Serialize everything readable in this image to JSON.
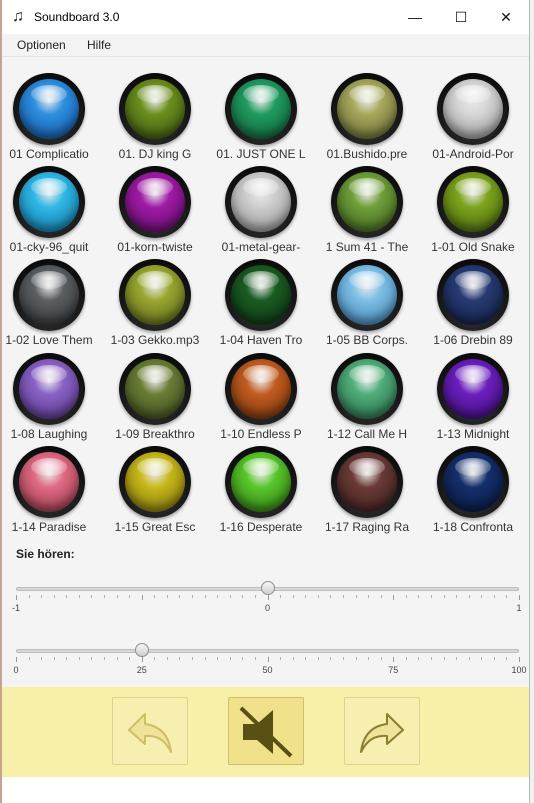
{
  "window": {
    "title": "Soundboard 3.0",
    "app_icon": "music-note-icon",
    "controls": [
      "minimize-icon",
      "maximize-icon",
      "close-icon"
    ],
    "min_glyph": "—",
    "max_glyph": "☐",
    "close_glyph": "✕"
  },
  "menu": [
    "Optionen",
    "Hilfe"
  ],
  "sounds": [
    {
      "label": "01 Complicatio",
      "color": "#2e8fe0",
      "dark": "#0f4f9a"
    },
    {
      "label": "01. DJ king G",
      "color": "#6b8f1c",
      "dark": "#365010"
    },
    {
      "label": "01. JUST ONE L",
      "color": "#1f9b5f",
      "dark": "#0f5c36"
    },
    {
      "label": "01.Bushido.pre",
      "color": "#a7a85a",
      "dark": "#5f6030"
    },
    {
      "label": "01-Android-Por",
      "color": "#d6d6d6",
      "dark": "#8a8a8a"
    },
    {
      "label": "01-cky-96_quit",
      "color": "#30b8e6",
      "dark": "#106f9a"
    },
    {
      "label": "01-korn-twiste",
      "color": "#a01aa6",
      "dark": "#5c0c62"
    },
    {
      "label": "01-metal-gear-",
      "color": "#cdcdcd",
      "dark": "#8a8a8a"
    },
    {
      "label": "1 Sum 41 - The",
      "color": "#6e9f38",
      "dark": "#3d5c1c"
    },
    {
      "label": "1-01 Old Snake",
      "color": "#7da31c",
      "dark": "#44600e"
    },
    {
      "label": "1-02 Love Them",
      "color": "#5a5f63",
      "dark": "#2e3133"
    },
    {
      "label": "1-03 Gekko.mp3",
      "color": "#9aa630",
      "dark": "#586018"
    },
    {
      "label": "1-04 Haven Tro",
      "color": "#1a5c22",
      "dark": "#0b3010"
    },
    {
      "label": "1-05 BB Corps.",
      "color": "#7dbfe6",
      "dark": "#3a79a8"
    },
    {
      "label": "1-06 Drebin 89",
      "color": "#273b73",
      "dark": "#101d40"
    },
    {
      "label": "1-08 Laughing",
      "color": "#8a62c6",
      "dark": "#4e3380"
    },
    {
      "label": "1-09 Breakthro",
      "color": "#6a7d35",
      "dark": "#38461a"
    },
    {
      "label": "1-10 Endless P",
      "color": "#c25c1f",
      "dark": "#6f300c"
    },
    {
      "label": "1-12 Call Me H",
      "color": "#4fae7a",
      "dark": "#266343"
    },
    {
      "label": "1-13 Midnight",
      "color": "#6b1fbe",
      "dark": "#380c6e"
    },
    {
      "label": "1-14 Paradise",
      "color": "#e06a84",
      "dark": "#8a3346"
    },
    {
      "label": "1-15 Great Esc",
      "color": "#c8b81a",
      "dark": "#766b0a"
    },
    {
      "label": "1-16 Desperate",
      "color": "#58c72a",
      "dark": "#2c7212"
    },
    {
      "label": "1-17 Raging Ra",
      "color": "#6a3a36",
      "dark": "#3a1d1b"
    },
    {
      "label": "1-18 Confronta",
      "color": "#152f6b",
      "dark": "#08173a"
    }
  ],
  "now_playing_label": "Sie hören:",
  "balance": {
    "min": -1,
    "max": 1,
    "value": 0,
    "labels": [
      "-1",
      "0",
      "1"
    ]
  },
  "volume": {
    "min": 0,
    "max": 100,
    "value": 25,
    "labels": [
      "0",
      "25",
      "50",
      "75",
      "100"
    ]
  },
  "toolbar": {
    "back": "back-arrow-icon",
    "mute": "mute-speaker-icon",
    "forward": "forward-arrow-icon"
  },
  "colors": {
    "toolbar_bg": "#f8f0a9",
    "content_bg": "#f4f4f4"
  }
}
